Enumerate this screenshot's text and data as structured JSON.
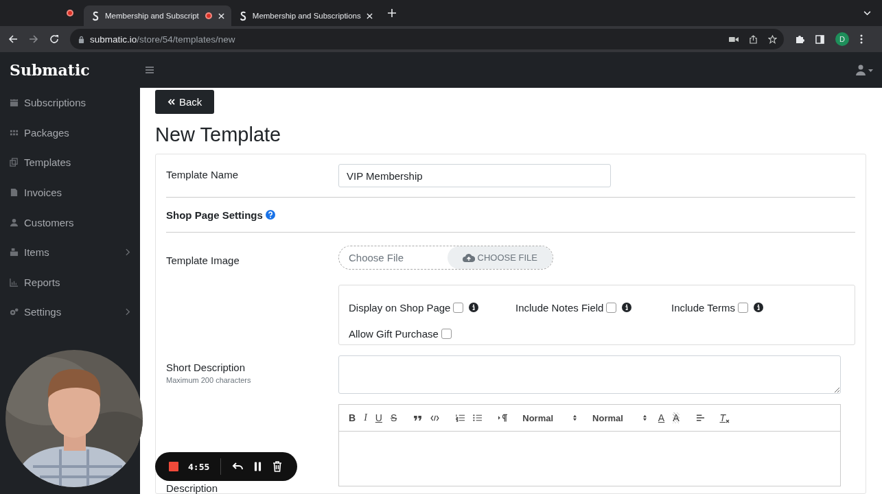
{
  "browser": {
    "tabs": [
      {
        "title": "Membership and Subscript",
        "selected": true,
        "recording": true
      },
      {
        "title": "Membership and Subscriptions",
        "selected": false,
        "recording": false
      }
    ],
    "address": {
      "host": "submatic.io",
      "path": "/store/54/templates/new"
    },
    "profile_initial": "D"
  },
  "app": {
    "logo": "Submatic"
  },
  "sidebar": {
    "items": [
      {
        "label": "Subscriptions",
        "submenu": false
      },
      {
        "label": "Packages",
        "submenu": false
      },
      {
        "label": "Templates",
        "submenu": false
      },
      {
        "label": "Invoices",
        "submenu": false
      },
      {
        "label": "Customers",
        "submenu": false
      },
      {
        "label": "Items",
        "submenu": true
      },
      {
        "label": "Reports",
        "submenu": false
      },
      {
        "label": "Settings",
        "submenu": true
      }
    ]
  },
  "back_button": "Back",
  "page_title": "New Template",
  "form": {
    "template_name": {
      "label": "Template Name",
      "value": "VIP Membership"
    },
    "section_title": "Shop Page Settings",
    "template_image": {
      "label": "Template Image",
      "placeholder": "Choose File",
      "button": "CHOOSE FILE"
    },
    "options": [
      {
        "label": "Display on Shop Page",
        "checked": false,
        "info": true
      },
      {
        "label": "Include Notes Field",
        "checked": false,
        "info": true
      },
      {
        "label": "Include Terms",
        "checked": false,
        "info": true
      },
      {
        "label": "Allow Gift Purchase",
        "checked": false,
        "info": false
      }
    ],
    "short_description": {
      "label": "Short Description",
      "hint": "Maximum 200 characters"
    },
    "editor_toolbar": [
      {
        "kind": "bold",
        "label": "B"
      },
      {
        "kind": "italic",
        "label": "I"
      },
      {
        "kind": "underline",
        "label": "U"
      },
      {
        "kind": "strike",
        "label": "S"
      },
      {
        "kind": "quote"
      },
      {
        "kind": "code"
      },
      {
        "kind": "ordered"
      },
      {
        "kind": "bullet"
      },
      {
        "kind": "direction"
      },
      {
        "kind": "select",
        "label": "Normal"
      },
      {
        "kind": "select",
        "label": "Normal"
      },
      {
        "kind": "color",
        "label": "A"
      },
      {
        "kind": "background",
        "label": "A"
      },
      {
        "kind": "align"
      },
      {
        "kind": "clean",
        "label": "T"
      }
    ],
    "description": {
      "label": "Description"
    }
  },
  "recorder": {
    "time": "4:55"
  }
}
